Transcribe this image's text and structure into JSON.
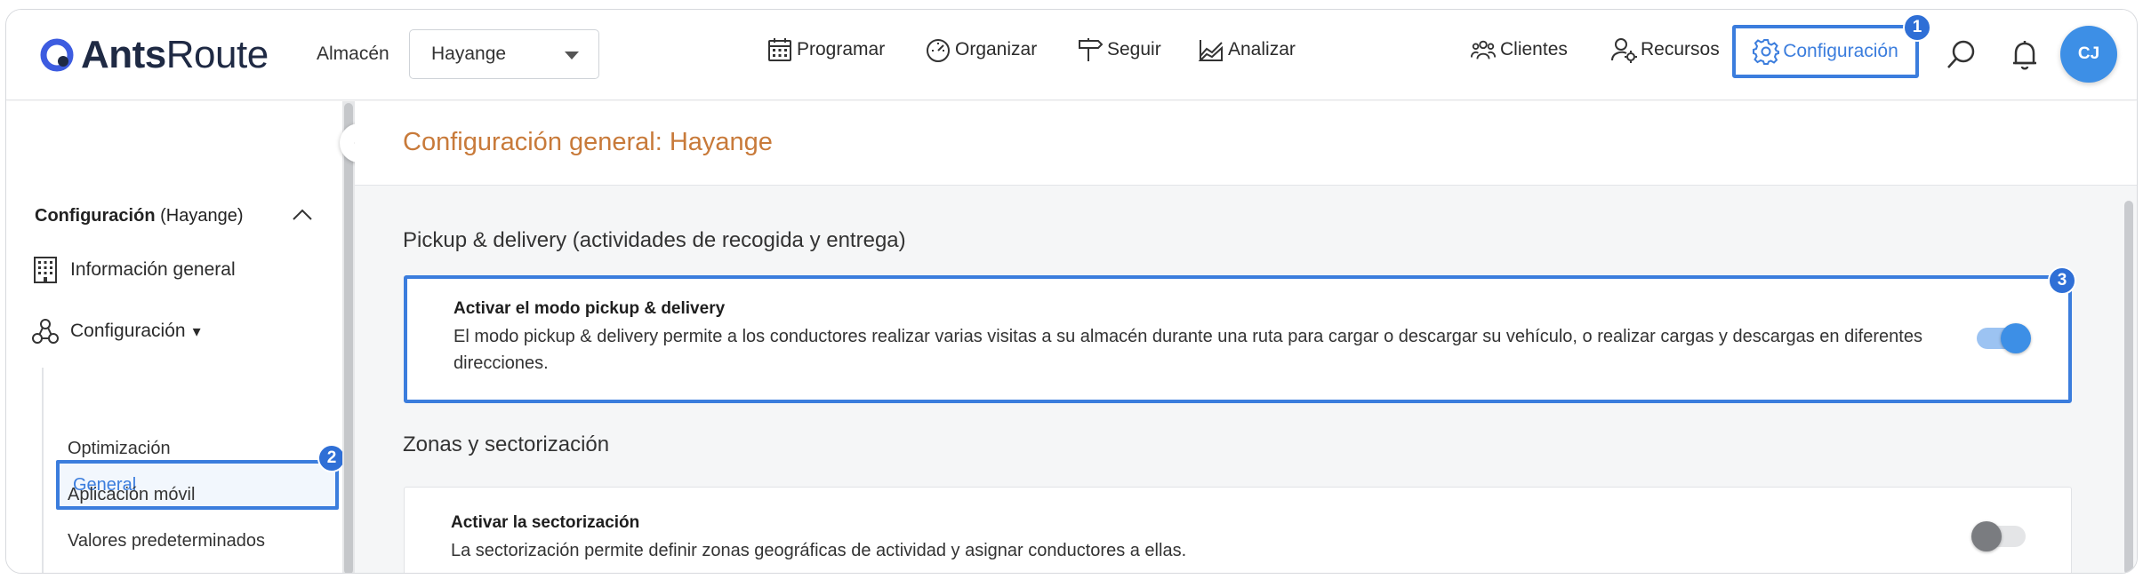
{
  "header": {
    "logo": {
      "bold": "Ants",
      "regular": "Route"
    },
    "almacen_label": "Almacén",
    "almacen_value": "Hayange",
    "nav": [
      {
        "label": "Programar",
        "icon": "calendar-icon"
      },
      {
        "label": "Organizar",
        "icon": "gauge-icon"
      },
      {
        "label": "Seguir",
        "icon": "signpost-icon"
      },
      {
        "label": "Analizar",
        "icon": "chart-icon"
      },
      {
        "label": "Clientes",
        "icon": "users-icon"
      },
      {
        "label": "Recursos",
        "icon": "user-gear-icon"
      },
      {
        "label": "Configuración",
        "icon": "gear-icon"
      }
    ],
    "avatar_initials": "CJ"
  },
  "badges": {
    "one": "1",
    "two": "2",
    "three": "3"
  },
  "sidebar": {
    "title_bold": "Configuración",
    "title_rest": " (Hayange)",
    "items": [
      {
        "label": "Información general"
      },
      {
        "label": "Configuración",
        "caret": "▾"
      }
    ],
    "subitems": [
      {
        "label": "General"
      },
      {
        "label": "Optimización"
      },
      {
        "label": "Aplicación móvil"
      },
      {
        "label": "Valores predeterminados"
      }
    ]
  },
  "main": {
    "page_title": "Configuración general: Hayange",
    "sections": [
      {
        "title": "Pickup & delivery (actividades de recogida y entrega)",
        "card_title": "Activar el modo pickup & delivery",
        "card_desc": "El modo pickup & delivery permite a los conductores realizar varias visitas a su almacén durante una ruta para cargar o descargar su vehículo, o realizar cargas y descargas en diferentes direcciones.",
        "toggle": "on"
      },
      {
        "title": "Zonas y sectorización",
        "card_title": "Activar la sectorización",
        "card_desc": "La sectorización permite definir zonas geográficas de actividad y asignar conductores a ellas.",
        "toggle": "off"
      }
    ]
  },
  "colors": {
    "accent": "#3b7ddd",
    "title_orange": "#c87a3a",
    "avatar": "#3d8fe6"
  }
}
